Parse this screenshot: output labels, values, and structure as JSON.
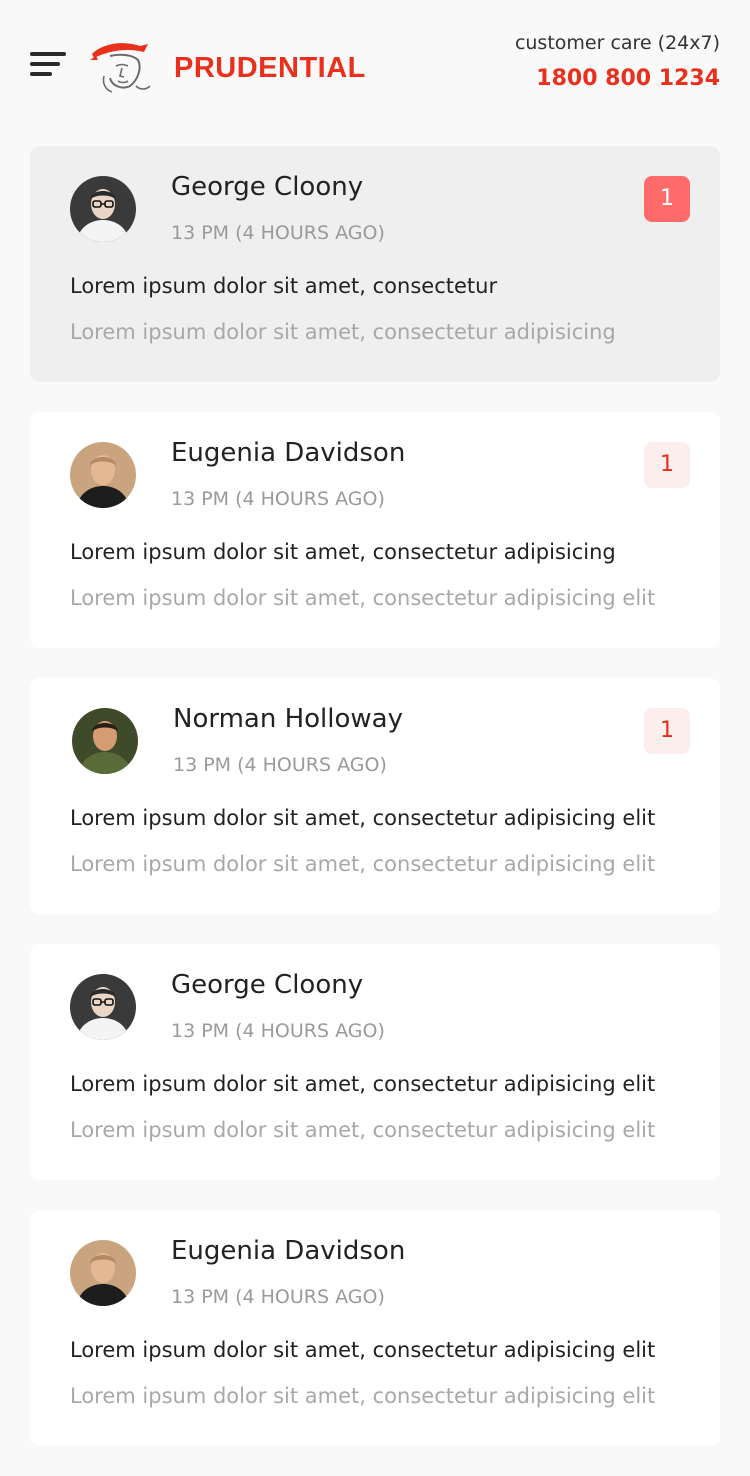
{
  "header": {
    "brand": "PRUDENTIAL",
    "care_label": "customer care (24x7)",
    "care_phone": "1800 800 1234"
  },
  "colors": {
    "accent": "#e8301c",
    "badge_strong": "#ff6b6b",
    "badge_soft": "#fdeeee"
  },
  "icons": {
    "menu": "hamburger-menu-icon",
    "logo": "prudential-logo"
  },
  "messages": [
    {
      "name": "George Cloony",
      "time": "13 PM (4 HOURS AGO)",
      "preview": "Lorem ipsum dolor sit amet, consectetur",
      "subtext": "Lorem ipsum dolor sit amet, consectetur adipisicing",
      "badge": "1",
      "unread": true
    },
    {
      "name": "Eugenia Davidson",
      "time": "13 PM (4 HOURS AGO)",
      "preview": "Lorem ipsum dolor sit amet, consectetur adipisicing",
      "subtext": "Lorem ipsum dolor sit amet, consectetur adipisicing elit",
      "badge": "1",
      "unread": false
    },
    {
      "name": "Norman Holloway",
      "time": "13 PM (4 HOURS AGO)",
      "preview": "Lorem ipsum dolor sit amet, consectetur adipisicing elit",
      "subtext": "Lorem ipsum dolor sit amet, consectetur adipisicing elit",
      "badge": "1",
      "unread": false
    },
    {
      "name": "George Cloony",
      "time": "13 PM (4 HOURS AGO)",
      "preview": "Lorem ipsum dolor sit amet, consectetur adipisicing elit",
      "subtext": "Lorem ipsum dolor sit amet, consectetur adipisicing elit",
      "badge": "",
      "unread": false
    },
    {
      "name": "Eugenia Davidson",
      "time": "13 PM (4 HOURS AGO)",
      "preview": "Lorem ipsum dolor sit amet, consectetur adipisicing elit",
      "subtext": "Lorem ipsum dolor sit amet, consectetur adipisicing elit",
      "badge": "",
      "unread": false
    }
  ]
}
